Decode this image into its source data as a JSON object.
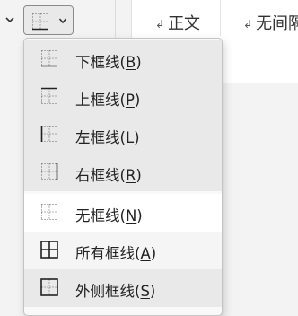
{
  "ribbon": {
    "styles": [
      {
        "mark": "↲",
        "label": "正文"
      },
      {
        "mark": "↲",
        "label": "无间隔"
      }
    ]
  },
  "borders_menu": {
    "items": [
      {
        "text": "下框线(",
        "key": "B",
        "tail": ")",
        "icon": "bottom-border-icon"
      },
      {
        "text": "上框线(",
        "key": "P",
        "tail": ")",
        "icon": "top-border-icon"
      },
      {
        "text": "左框线(",
        "key": "L",
        "tail": ")",
        "icon": "left-border-icon"
      },
      {
        "text": "右框线(",
        "key": "R",
        "tail": ")",
        "icon": "right-border-icon"
      },
      {
        "text": "无框线(",
        "key": "N",
        "tail": ")",
        "icon": "no-border-icon"
      },
      {
        "text": "所有框线(",
        "key": "A",
        "tail": ")",
        "icon": "all-borders-icon"
      },
      {
        "text": "外侧框线(",
        "key": "S",
        "tail": ")",
        "icon": "outside-borders-icon"
      }
    ]
  }
}
